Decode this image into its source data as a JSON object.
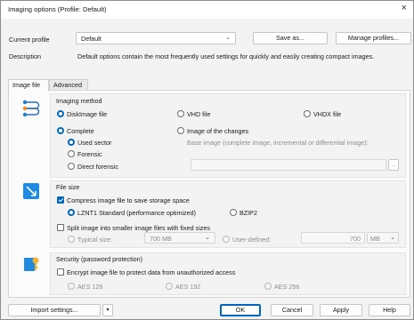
{
  "window": {
    "title": "Imaging options (Profile: Default)",
    "close_glyph": "×"
  },
  "profile": {
    "label": "Current profile",
    "value": "Default",
    "save_as": "Save as...",
    "manage": "Manage profiles...",
    "description_label": "Description",
    "description": "Default options contain the most frequently used settings for quickly and easily creating compact images."
  },
  "tabs": [
    {
      "label": "Image file",
      "active": true
    },
    {
      "label": "Advanced",
      "active": false
    }
  ],
  "imaging_method": {
    "title": "Imaging method",
    "icon": "imaging-method-icon",
    "formats": [
      "DiskImage file",
      "VHD file",
      "VHDX file"
    ],
    "selected_format": "DiskImage file",
    "complete": "Complete",
    "image_of_changes": "Image of the changes",
    "base_image_label": "Base image (complete image, incremental or differential image):",
    "sub_options": [
      "Used sector",
      "Forensic",
      "Direct forensic"
    ],
    "selected_sub": "Used sector",
    "browse": "..."
  },
  "file_size": {
    "title": "File size",
    "icon": "file-size-icon",
    "compress_label": "Compress image file to save storage space",
    "compress_checked": true,
    "algo_lznt1": "LZNT1 Standard (performance optimized)",
    "algo_bzip2": "BZIP2",
    "selected_algo": "LZNT1",
    "split_label": "Split image into smaller image files with fixed sizes",
    "split_checked": false,
    "typical_label": "Typical size:",
    "typical_value": "700 MB",
    "user_defined_label": "User-defined:",
    "user_value": "700",
    "user_unit": "MB"
  },
  "security": {
    "title": "Security (password protection)",
    "icon": "security-icon",
    "encrypt_label": "Encrypt image file to protect data from unauthorized access",
    "encrypt_checked": false,
    "aes": [
      "AES 128",
      "AES 192",
      "AES 256"
    ]
  },
  "footer": {
    "import": "Import settings...",
    "ok": "OK",
    "cancel": "Cancel",
    "apply": "Apply",
    "help": "Help"
  },
  "colors": {
    "accent": "#0067c0",
    "window_bg": "#f3f3f3"
  }
}
